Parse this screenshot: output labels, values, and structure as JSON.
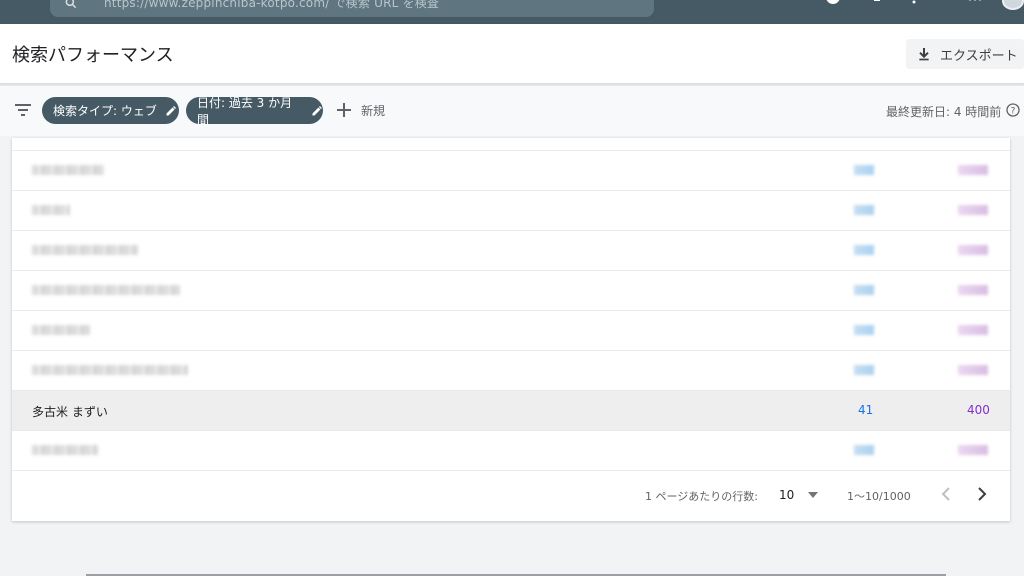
{
  "topbar": {
    "search_text": "https://www.zeppinchiba-kotpo.com/ で検索 URL を検査"
  },
  "header": {
    "title": "検索パフォーマンス",
    "export_label": "エクスポート"
  },
  "filters": {
    "chip1": "検索タイプ: ウェブ",
    "chip2": "日付: 過去 3 か月間",
    "new_label": "新規",
    "updated": "最終更新日: 4 時間前"
  },
  "table": {
    "visible_row": {
      "query": "多古米 まずい",
      "clicks": "41",
      "impressions": "400"
    }
  },
  "pagination": {
    "rows_per_page_label": "1 ページあたりの行数:",
    "rows_per_page": "10",
    "range": "1〜10/1000"
  },
  "colors": {
    "topbar": "#455a64",
    "chip": "#455a64",
    "clicks": "#1a73e8",
    "impressions": "#8430ce"
  }
}
